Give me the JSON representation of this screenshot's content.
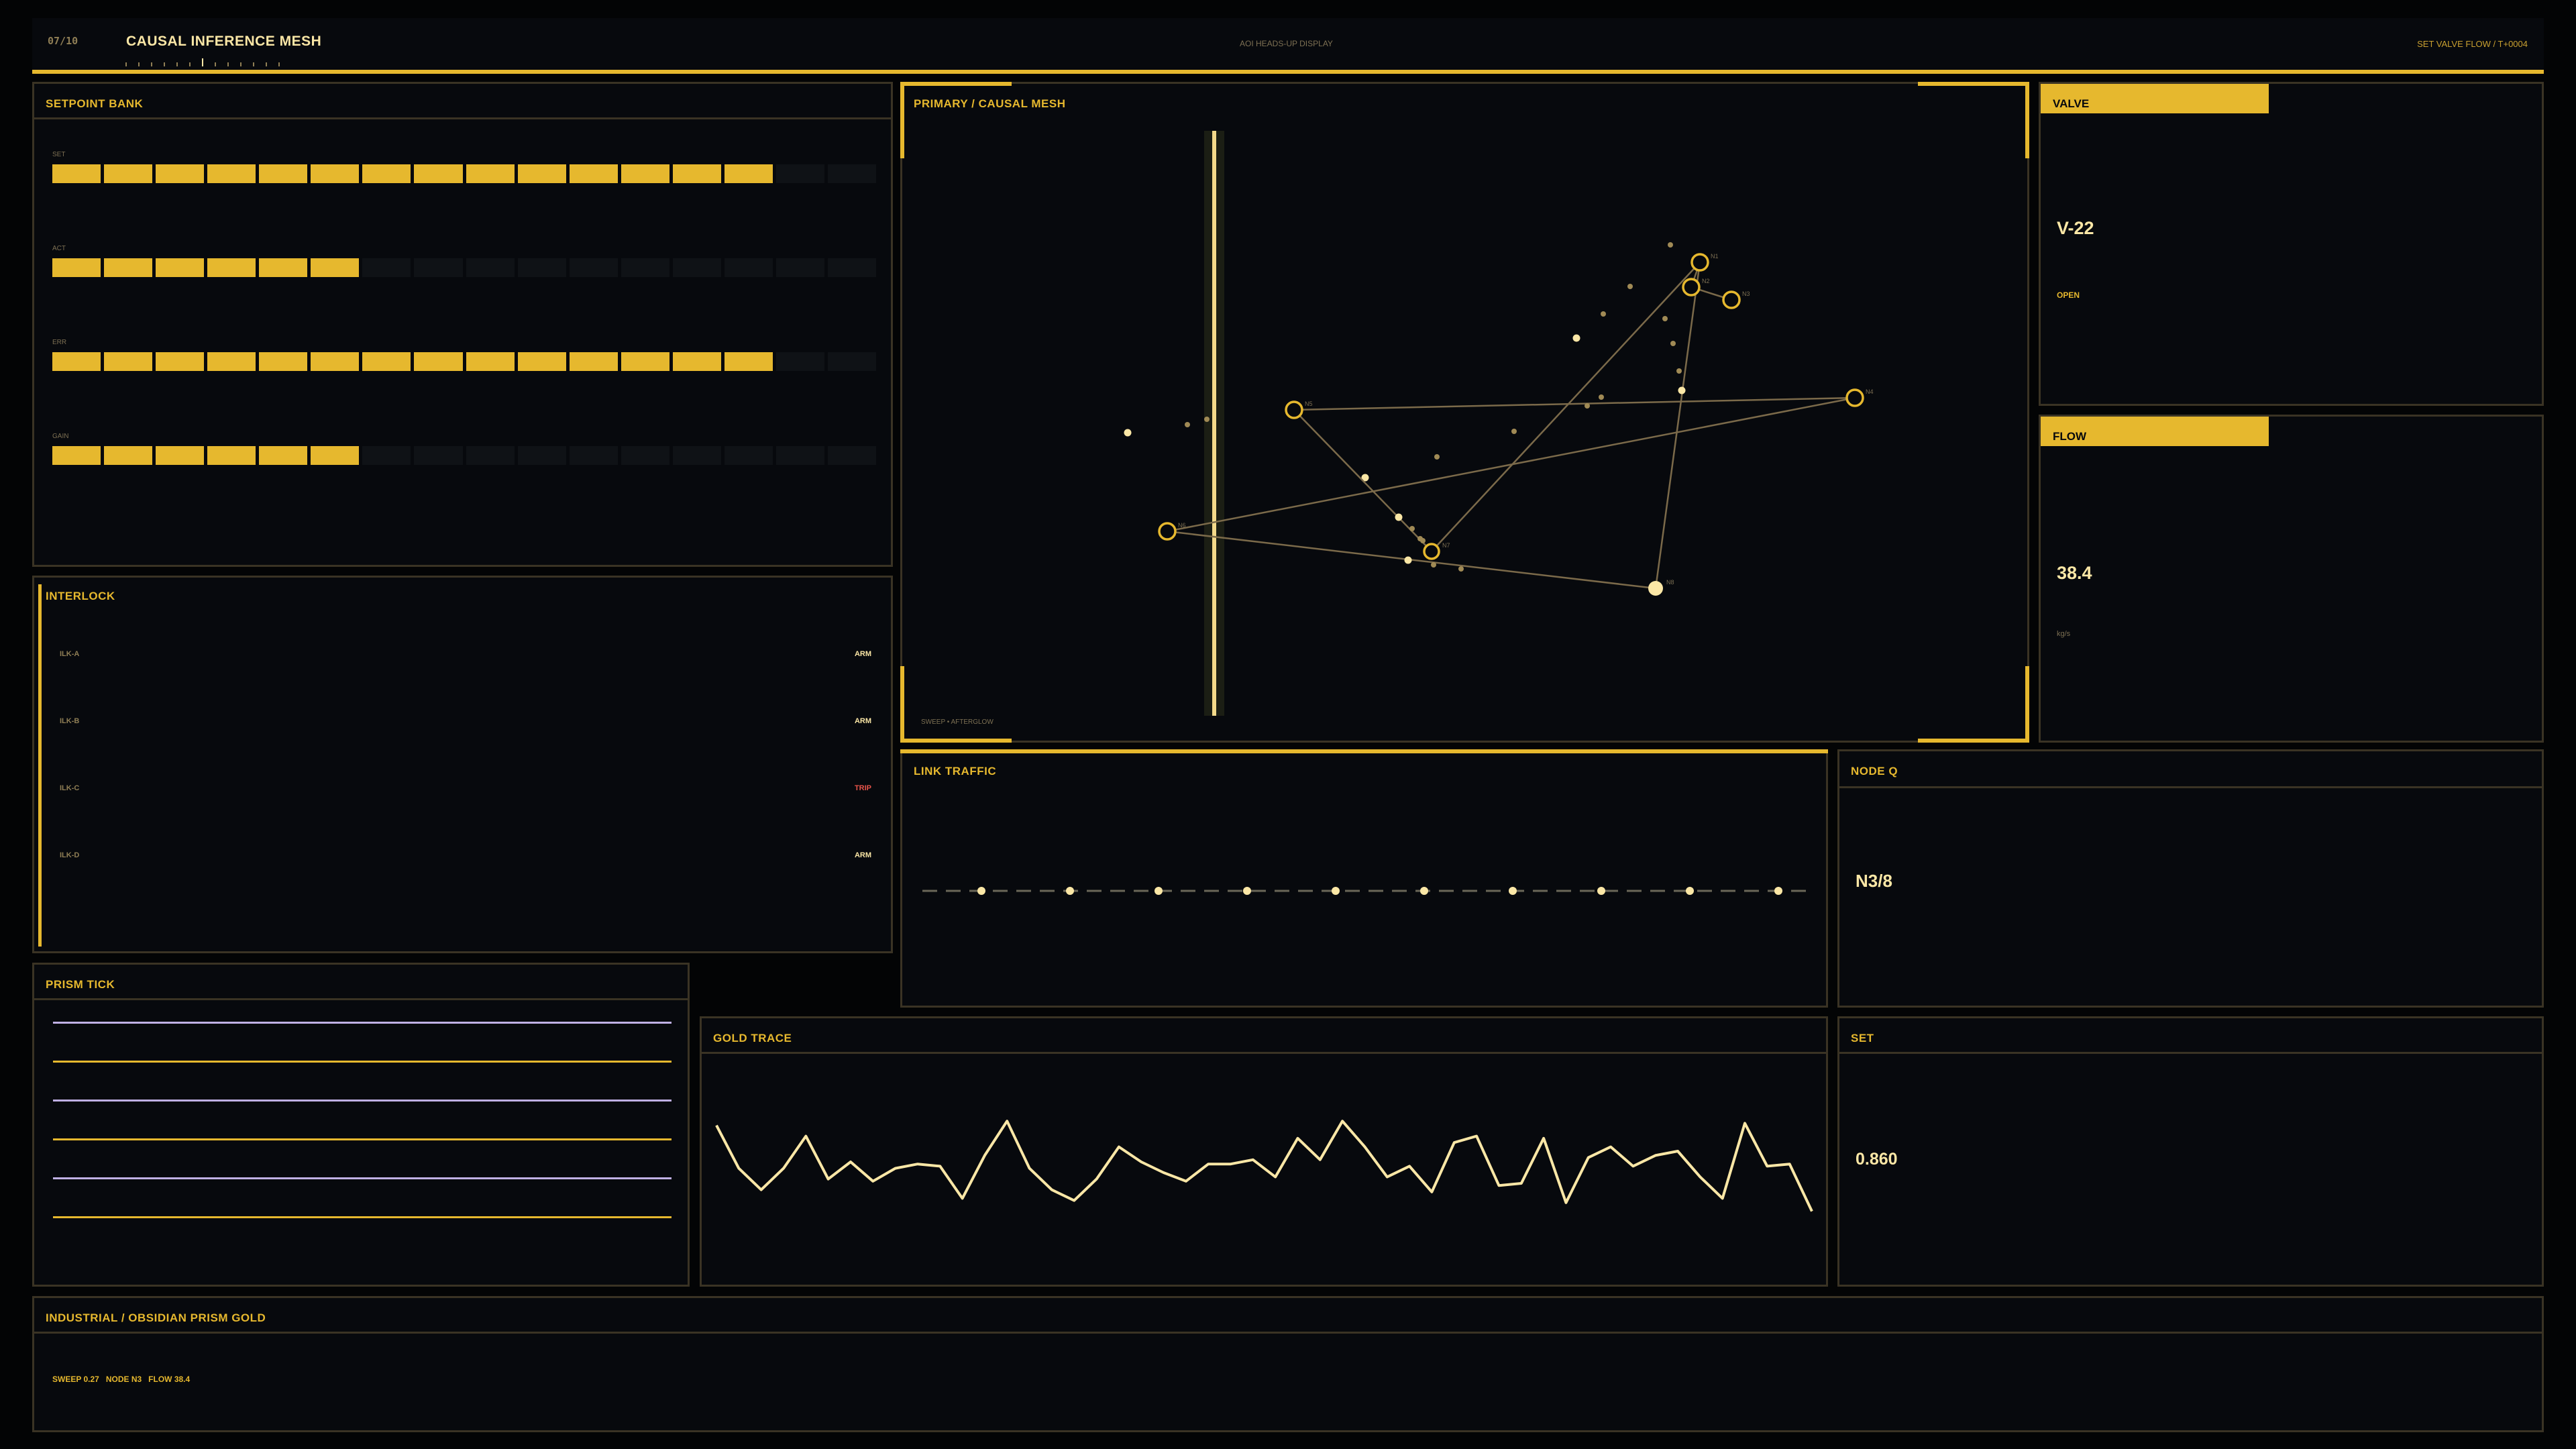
{
  "header": {
    "page_counter": "07/10",
    "title": "CAUSAL INFERENCE MESH",
    "subtitle": "AOI HEADS-UP DISPLAY",
    "status": "SET VALVE FLOW / T+0004"
  },
  "setpoint_bank": {
    "title": "SETPOINT BANK",
    "rows": [
      {
        "label": "SET",
        "value": 0.875
      },
      {
        "label": "ACT",
        "value": 0.375
      },
      {
        "label": "ERR",
        "value": 0.875
      },
      {
        "label": "GAIN",
        "value": 0.375
      }
    ]
  },
  "interlock": {
    "title": "INTERLOCK",
    "rows": [
      {
        "name": "ILK-A",
        "state": "ARM"
      },
      {
        "name": "ILK-B",
        "state": "ARM"
      },
      {
        "name": "ILK-C",
        "state": "TRIP"
      },
      {
        "name": "ILK-D",
        "state": "ARM"
      }
    ]
  },
  "mesh": {
    "title": "PRIMARY / CAUSAL MESH",
    "footer": "SWEEP • AFTERGLOW",
    "node_labels": [
      "N1",
      "N2",
      "N3",
      "N4",
      "N5",
      "N6",
      "N7",
      "N8"
    ]
  },
  "valve": {
    "title": "VALVE",
    "value": "V-22",
    "state": "OPEN"
  },
  "flow": {
    "title": "FLOW",
    "value": "38.4",
    "unit": "kg/s"
  },
  "link_traffic": {
    "title": "LINK TRAFFIC"
  },
  "node_q": {
    "title": "NODE Q",
    "value": "N3/8"
  },
  "prism_tick": {
    "title": "PRISM TICK",
    "colors": [
      "#bfb0e4",
      "#e6b82e",
      "#bfb0e4",
      "#e6b82e",
      "#bfb0e4",
      "#e6b82e"
    ]
  },
  "gold_trace": {
    "title": "GOLD TRACE",
    "values": [
      0.72,
      0.52,
      0.42,
      0.52,
      0.67,
      0.47,
      0.55,
      0.46,
      0.52,
      0.54,
      0.53,
      0.38,
      0.58,
      0.74,
      0.52,
      0.42,
      0.37,
      0.47,
      0.62,
      0.55,
      0.5,
      0.46,
      0.54,
      0.54,
      0.56,
      0.48,
      0.66,
      0.56,
      0.74,
      0.62,
      0.48,
      0.53,
      0.41,
      0.64,
      0.67,
      0.44,
      0.45,
      0.66,
      0.36,
      0.57,
      0.62,
      0.53,
      0.58,
      0.6,
      0.48,
      0.38,
      0.73,
      0.53,
      0.54,
      0.32
    ]
  },
  "set": {
    "title": "SET",
    "value": "0.860"
  },
  "footer": {
    "title": "INDUSTRIAL / OBSIDIAN PRISM GOLD",
    "stats": "SWEEP 0.27   NODE N3   FLOW 38.4"
  }
}
